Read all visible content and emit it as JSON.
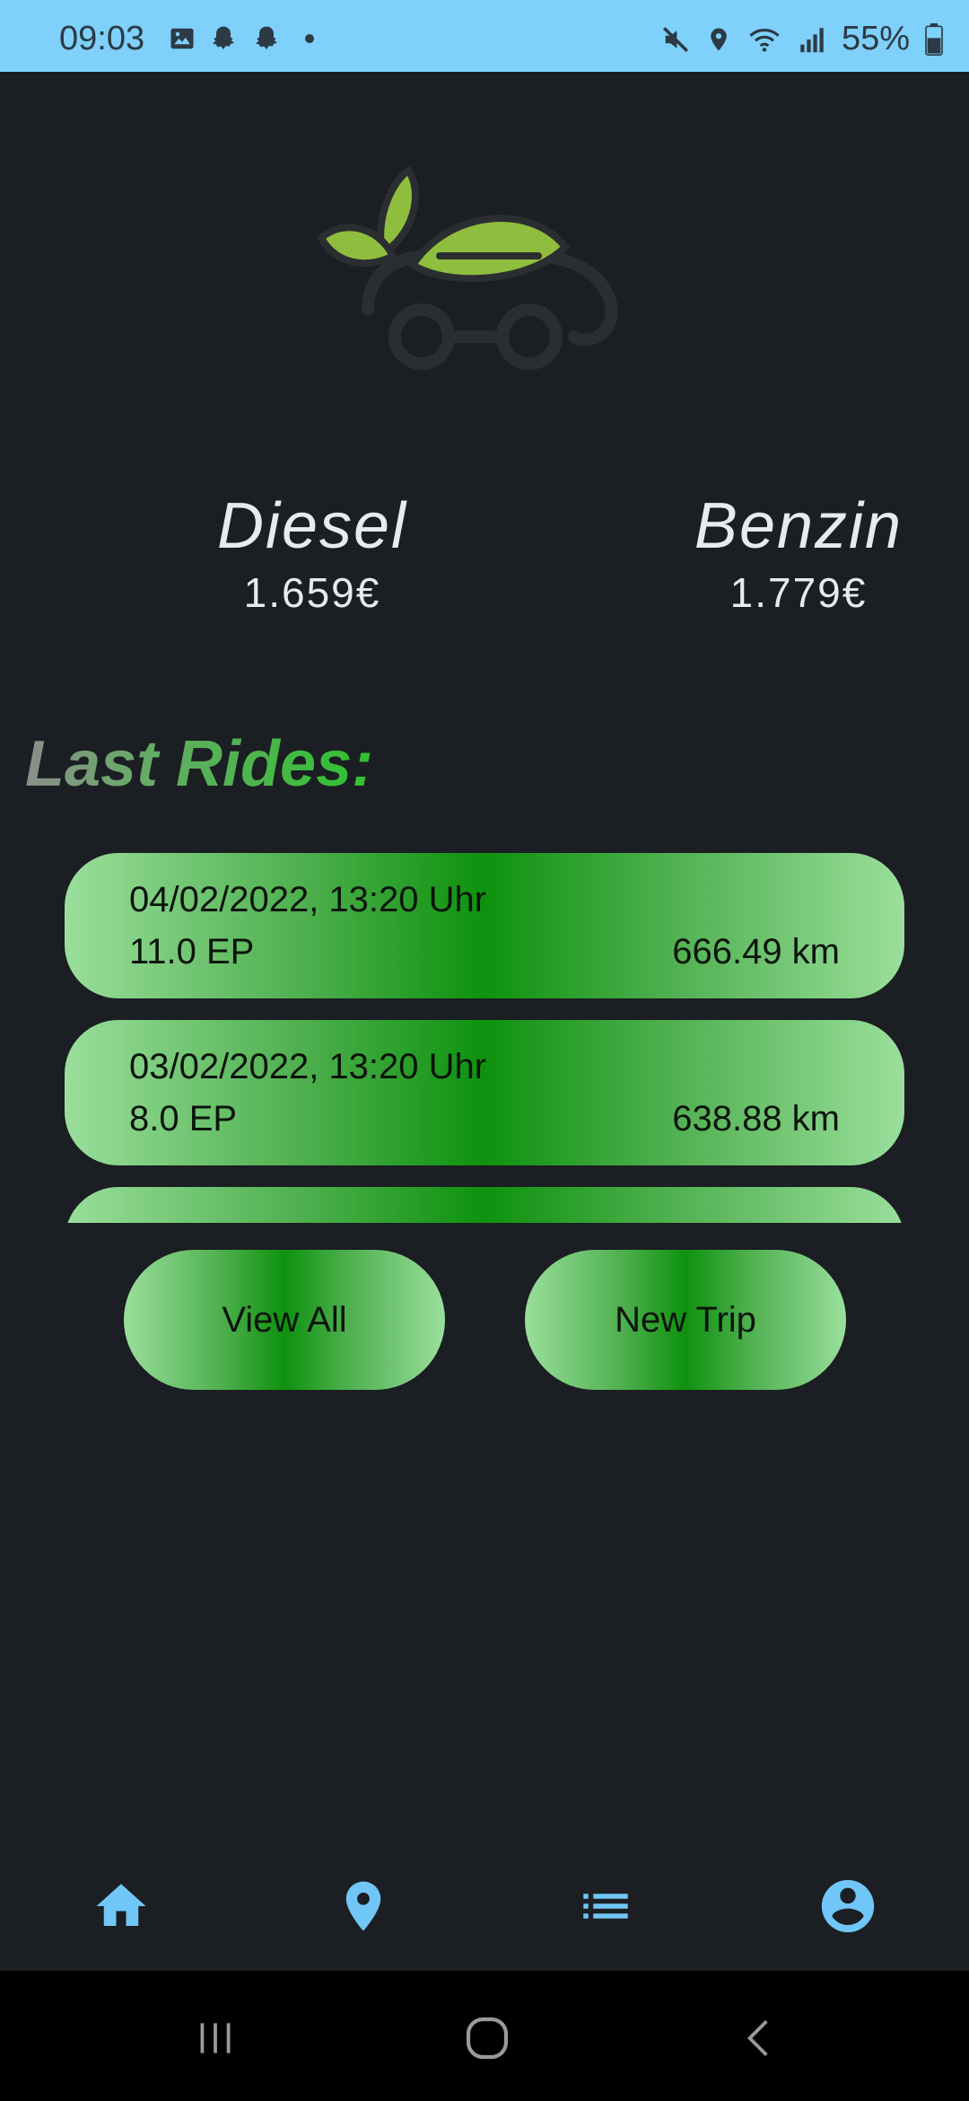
{
  "status_bar": {
    "time": "09:03",
    "battery": "55%"
  },
  "fuel_prices": [
    {
      "name": "Diesel",
      "price": "1.659€"
    },
    {
      "name": "Benzin",
      "price": "1.779€"
    }
  ],
  "section_title": "Last Rides:",
  "rides": [
    {
      "date": "04/02/2022, 13:20 Uhr",
      "ep": "11.0 EP",
      "distance": "666.49 km"
    },
    {
      "date": "03/02/2022, 13:20 Uhr",
      "ep": "8.0 EP",
      "distance": "638.88 km"
    },
    {
      "date": "",
      "ep": "",
      "distance": ""
    }
  ],
  "buttons": {
    "view_all": "View All",
    "new_trip": "New Trip"
  },
  "bottom_nav": [
    {
      "icon": "home-icon"
    },
    {
      "icon": "location-pin-icon"
    },
    {
      "icon": "list-icon"
    },
    {
      "icon": "account-icon"
    }
  ],
  "colors": {
    "status_bar": "#7fd0fb",
    "background": "#1b1e22",
    "accent_green": "#0e920e",
    "nav_icon": "#6fc6f7"
  }
}
